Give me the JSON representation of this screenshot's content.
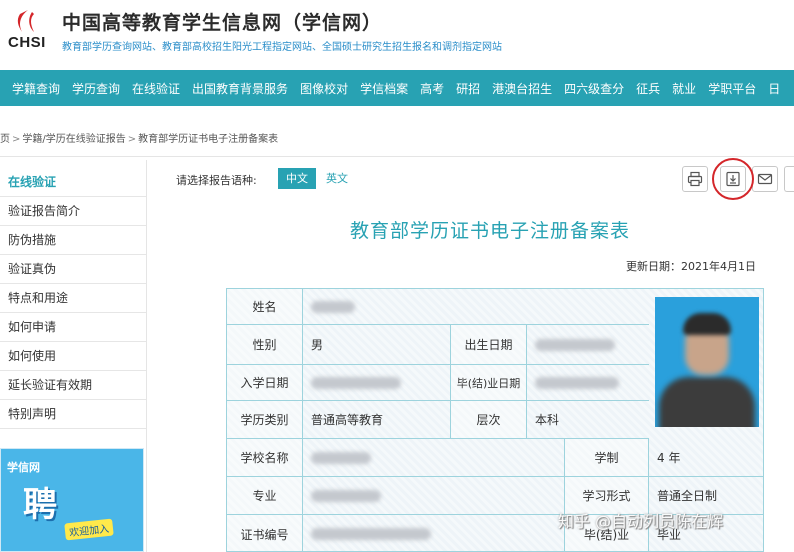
{
  "header": {
    "title": "中国高等教育学生信息网（学信网）",
    "subtitle": "教育部学历查询网站、教育部高校招生阳光工程指定网站、全国硕士研究生招生报名和调剂指定网站",
    "logo_text": "CHSI"
  },
  "nav": {
    "items": [
      "学籍查询",
      "学历查询",
      "在线验证",
      "出国教育背景服务",
      "图像校对",
      "学信档案",
      "高考",
      "研招",
      "港澳台招生",
      "四六级查分",
      "征兵",
      "就业",
      "学职平台",
      "日"
    ]
  },
  "breadcrumb": [
    "页",
    "学籍/学历在线验证报告",
    "教育部学历证书电子注册备案表"
  ],
  "sidebar": {
    "items": [
      "在线验证",
      "验证报告简介",
      "防伪措施",
      "验证真伪",
      "特点和用途",
      "如何申请",
      "如何使用",
      "延长验证有效期",
      "特别声明"
    ],
    "active_index": 0,
    "ad": {
      "logo": "学信网",
      "big": "聘",
      "small": "欢迎加入"
    }
  },
  "language": {
    "label": "请选择报告语种:",
    "options": [
      "中文",
      "英文"
    ],
    "selected": "中文"
  },
  "tools": [
    "print-icon",
    "download-icon",
    "mail-icon"
  ],
  "document": {
    "title": "教育部学历证书电子注册备案表",
    "update_date": "更新日期：2021年4月1日",
    "fields": {
      "name_label": "姓名",
      "gender_label": "性别",
      "gender": "男",
      "birth_label": "出生日期",
      "enroll_label": "入学日期",
      "graduate_label": "毕(结)业日期",
      "type_label": "学历类别",
      "type": "普通高等教育",
      "level_label": "层次",
      "level": "本科",
      "school_label": "学校名称",
      "duration_label": "学制",
      "duration": "4 年",
      "major_label": "专业",
      "form_label": "学习形式",
      "form": "普通全日制",
      "cert_label": "证书编号",
      "status_label": "毕(结)业",
      "status": "毕业"
    }
  },
  "watermark": "知乎 @自动列员陈在辉",
  "colors": {
    "accent": "#28a2b3",
    "link": "#2a8ec9",
    "highlight": "#d4262a"
  }
}
